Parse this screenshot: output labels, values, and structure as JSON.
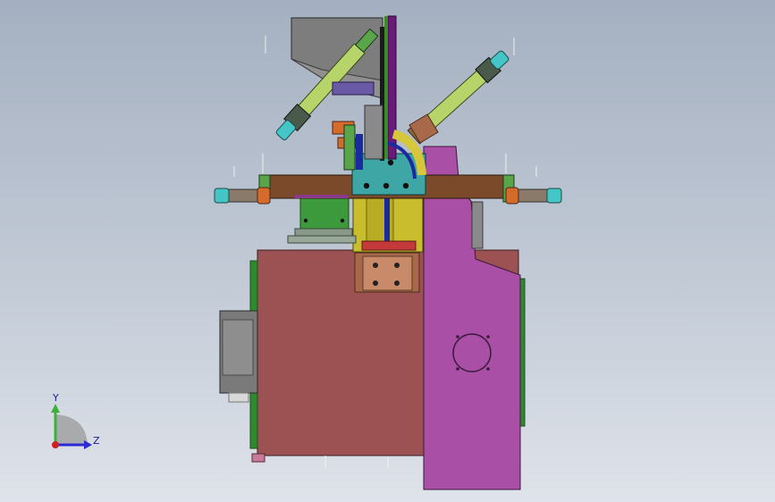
{
  "viewport": {
    "background_top": "#a4b0c1",
    "background_bottom": "#dfe3ea"
  },
  "triad": {
    "y_label": "Y",
    "z_label": "Z",
    "y_color": "#3cb03c",
    "z_color": "#2a2ad0",
    "x_color": "#d02020"
  },
  "model_colors": {
    "base_body": "#9c5252",
    "side_plate": "#a94fa6",
    "front_block": "#c9bd2e",
    "teal_block": "#3fa6a6",
    "brown_arm": "#7a4a2a",
    "gray_hopper": "#7d7d7d",
    "green_plate": "#3c9a3c",
    "dark_green": "#2d6d2d",
    "cyan_parts": "#45c6c6",
    "lime_parts": "#b7d46a",
    "orange_parts": "#d46b2a",
    "purple_rail": "#6a1a7a",
    "blue_rail": "#1a2aa0"
  }
}
